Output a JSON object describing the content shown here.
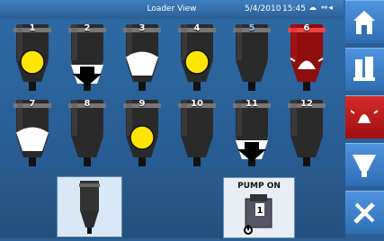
{
  "header": {
    "title": "Loader View",
    "date": "5/4/2010",
    "time": "15:45",
    "status_icons": "☁ ⇔◂"
  },
  "loaders": [
    {
      "number": "1",
      "state": "yellow"
    },
    {
      "number": "2",
      "state": "arrow"
    },
    {
      "number": "3",
      "state": "white"
    },
    {
      "number": "4",
      "state": "yellow"
    },
    {
      "number": "5",
      "state": "blue"
    },
    {
      "number": "6",
      "state": "alarm"
    },
    {
      "number": "7",
      "state": "white"
    },
    {
      "number": "8",
      "state": "empty"
    },
    {
      "number": "9",
      "state": "yellow"
    },
    {
      "number": "10",
      "state": "empty"
    },
    {
      "number": "11",
      "state": "arrow"
    },
    {
      "number": "12",
      "state": "empty"
    }
  ],
  "bottom": {
    "pump_label": "PUMP ON"
  },
  "sidebar": [
    "home-icon",
    "loaders-icon",
    "alarm-icon",
    "hopper-icon",
    "tools-icon"
  ]
}
